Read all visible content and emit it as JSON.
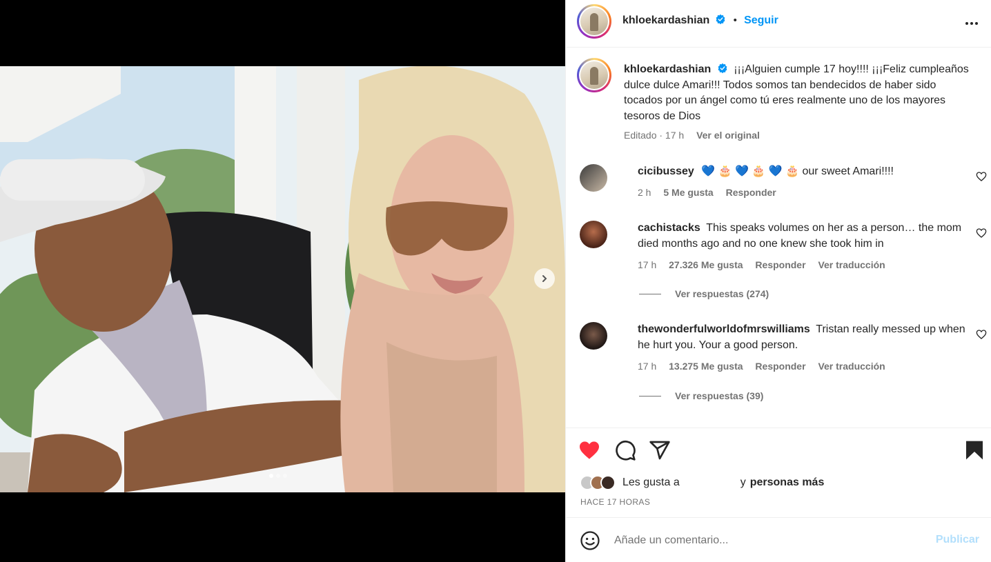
{
  "post": {
    "author": "khloekardashian",
    "follow_label": "Seguir",
    "bullet": "•",
    "caption": "¡¡¡Alguien cumple 17 hoy!!!! ¡¡¡Feliz cumpleaños dulce dulce Amari!!! Todos somos tan bendecidos de haber sido tocados por un ángel como tú  eres realmente uno de los mayores tesoros de Dios ",
    "caption_edited": "Editado · 17 h",
    "caption_original_link": "Ver el original",
    "carousel": {
      "total": 3,
      "active": 1
    }
  },
  "comments": [
    {
      "user": "cicibussey",
      "text": "💙 🎂 💙 🎂 💙 🎂 our sweet Amari!!!!",
      "time": "2 h",
      "likes": "5 Me gusta",
      "reply": "Responder"
    },
    {
      "user": "cachistacks",
      "text": "This speaks volumes on her as a person… the mom died months ago and no one knew she took him in",
      "time": "17 h",
      "likes": "27.326 Me gusta",
      "reply": "Responder",
      "translate": "Ver traducción",
      "replies": "Ver respuestas (274)"
    },
    {
      "user": "thewonderfulworldofmrswilliams",
      "text": "Tristan really messed up when he hurt you. Your a good person.",
      "time": "17 h",
      "likes": "13.275 Me gusta",
      "reply": "Responder",
      "translate": "Ver traducción",
      "replies": "Ver respuestas (39)"
    }
  ],
  "footer": {
    "likes_prefix": "Les gusta a",
    "likes_suffix_plain": "y",
    "likes_suffix_bold": "personas más",
    "timestamp": "HACE 17 HORAS",
    "comment_placeholder": "Añade un comentario...",
    "publish_label": "Publicar"
  },
  "icons": {
    "like": "heart-filled-icon",
    "comment": "comment-bubble-icon",
    "share": "paper-plane-icon",
    "save": "bookmark-filled-icon",
    "emoji": "smiley-icon",
    "more": "ellipsis-icon",
    "next": "chevron-right-icon",
    "verified": "verified-badge-icon"
  },
  "colors": {
    "like_red": "#ff3040",
    "link_blue": "#0095f6",
    "verified_blue": "#0095f6",
    "muted": "#737373",
    "publish_disabled": "#b2dffc"
  }
}
